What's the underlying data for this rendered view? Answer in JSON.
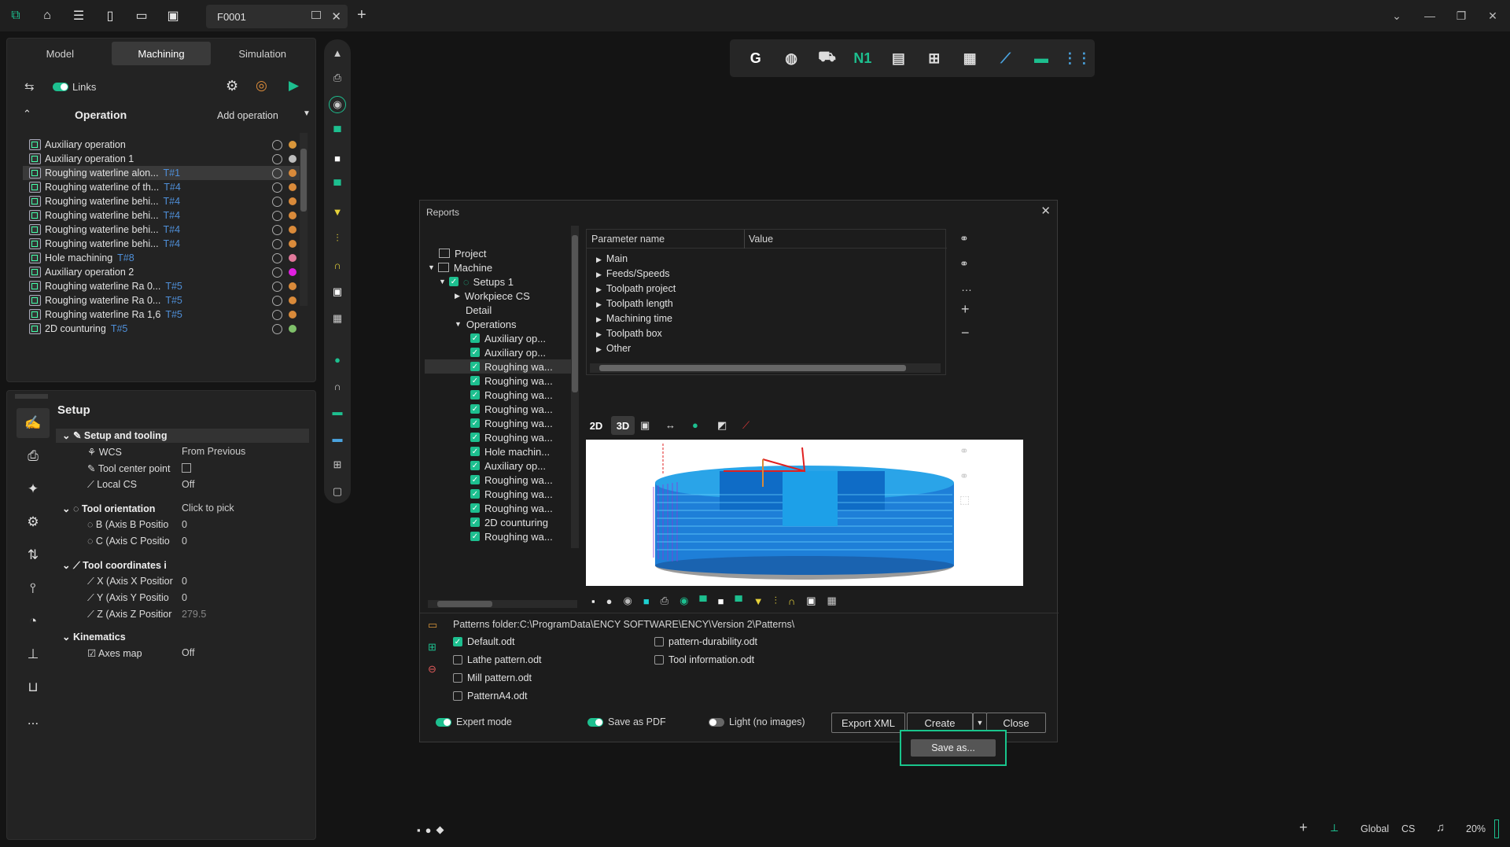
{
  "titlebar": {
    "doc_tab": "F0001",
    "icons": [
      "app-logo-icon",
      "home-icon",
      "menu-icon",
      "new-file-icon",
      "open-folder-icon",
      "save-icon"
    ]
  },
  "left_panel": {
    "tabs": [
      "Model",
      "Machining",
      "Simulation"
    ],
    "active_tab": "Machining",
    "links_label": "Links",
    "operation_header": "Operation",
    "add_operation": "Add operation",
    "operations": [
      {
        "name": "Auxiliary operation",
        "tool": "",
        "color": "#d9963a",
        "selected": false,
        "aux": true
      },
      {
        "name": "Auxiliary operation 1",
        "tool": "",
        "color": "#bdbdbd",
        "selected": false,
        "aux": true
      },
      {
        "name": "Roughing waterline alon...",
        "tool": "T#1",
        "color": "#d98a3a",
        "selected": true,
        "aux": false
      },
      {
        "name": "Roughing waterline of th...",
        "tool": "T#4",
        "color": "#d98a3a",
        "selected": false,
        "aux": false
      },
      {
        "name": "Roughing waterline behi...",
        "tool": "T#4",
        "color": "#d98a3a",
        "selected": false,
        "aux": false
      },
      {
        "name": "Roughing waterline behi...",
        "tool": "T#4",
        "color": "#d98a3a",
        "selected": false,
        "aux": false
      },
      {
        "name": "Roughing waterline behi...",
        "tool": "T#4",
        "color": "#d98a3a",
        "selected": false,
        "aux": false
      },
      {
        "name": "Roughing waterline behi...",
        "tool": "T#4",
        "color": "#d98a3a",
        "selected": false,
        "aux": false
      },
      {
        "name": "Hole machining",
        "tool": "T#8",
        "color": "#e0789a",
        "selected": false,
        "aux": false
      },
      {
        "name": "Auxiliary operation 2",
        "tool": "",
        "color": "#e020e0",
        "selected": false,
        "aux": true
      },
      {
        "name": "Roughing waterline Ra 0...",
        "tool": "T#5",
        "color": "#d98a3a",
        "selected": false,
        "aux": false
      },
      {
        "name": "Roughing waterline Ra 0...",
        "tool": "T#5",
        "color": "#d98a3a",
        "selected": false,
        "aux": false
      },
      {
        "name": "Roughing waterline Ra 1,6",
        "tool": "T#5",
        "color": "#d98a3a",
        "selected": false,
        "aux": false
      },
      {
        "name": "2D counturing",
        "tool": "T#5",
        "color": "#7fc06a",
        "selected": false,
        "aux": false
      }
    ]
  },
  "setup_panel": {
    "title": "Setup",
    "setup_and_tooling": "Setup and tooling",
    "wcs_label": "WCS",
    "wcs_value": "From Previous",
    "tcp_label": "Tool center point",
    "local_cs_label": "Local CS",
    "local_cs_value": "Off",
    "tool_orientation": "Tool orientation",
    "tool_orientation_value": "Click to pick",
    "axis_b": "B (Axis B Positio",
    "axis_b_value": "0",
    "axis_c": "C (Axis C Positio",
    "axis_c_value": "0",
    "tool_coords": "Tool coordinates i",
    "axis_x": "X (Axis X Positior",
    "axis_x_value": "0",
    "axis_y": "Y (Axis Y Positio",
    "axis_y_value": "0",
    "axis_z": "Z (Axis Z Positior",
    "axis_z_value": "279.5",
    "kinematics": "Kinematics",
    "axes_map": "Axes map",
    "axes_map_value": "Off",
    "more": "..."
  },
  "dialog": {
    "title": "Reports",
    "tree": {
      "project": "Project",
      "machine": "Machine",
      "setups": "Setups 1",
      "workpiece": "Workpiece CS",
      "detail": "Detail",
      "operations": "Operations",
      "ops": [
        "Auxiliary op...",
        "Auxiliary op...",
        "Roughing wa...",
        "Roughing wa...",
        "Roughing wa...",
        "Roughing wa...",
        "Roughing wa...",
        "Roughing wa...",
        "Hole machin...",
        "Auxiliary op...",
        "Roughing wa...",
        "Roughing wa...",
        "Roughing wa...",
        "2D counturing",
        "Roughing wa..."
      ]
    },
    "param_header": "Parameter name",
    "value_header": "Value",
    "params": [
      "Main",
      "Feeds/Speeds",
      "Toolpath project",
      "Toolpath length",
      "Machining time",
      "Toolpath box",
      "Other"
    ],
    "view_2d": "2D",
    "view_3d": "3D",
    "patterns_folder": "Patterns folder:C:\\ProgramData\\ENCY SOFTWARE\\ENCY\\Version 2\\Patterns\\",
    "patterns": [
      {
        "name": "Default.odt",
        "checked": true
      },
      {
        "name": "Lathe pattern.odt",
        "checked": false
      },
      {
        "name": "Mill pattern.odt",
        "checked": false
      },
      {
        "name": "PatternA4.odt",
        "checked": false
      },
      {
        "name": "pattern-durability.odt",
        "checked": false
      },
      {
        "name": "Tool information.odt",
        "checked": false
      }
    ],
    "expert_mode": "Expert mode",
    "save_as_pdf": "Save as PDF",
    "light": "Light (no images)",
    "export_xml": "Export XML",
    "create": "Create",
    "close": "Close",
    "save_as": "Save as..."
  },
  "statusbar": {
    "global": "Global",
    "cs": "CS",
    "zoom": "20%"
  },
  "colors": {
    "accent": "#1dbf8f",
    "highlight_border": "#19c58c"
  }
}
